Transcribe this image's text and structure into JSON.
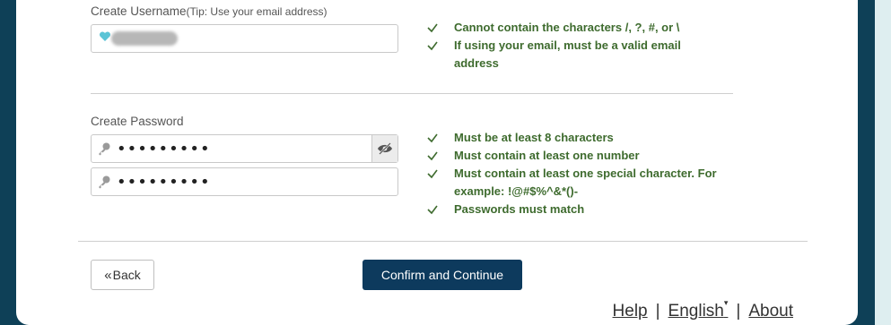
{
  "username": {
    "label": "Create Username",
    "tip": "(Tip: Use your email address)",
    "rules": [
      "Cannot contain the characters /, ?, #, or \\",
      "If using your email, must be a valid email address"
    ]
  },
  "password": {
    "label": "Create Password",
    "value_masked": "•••••••••",
    "confirm_masked": "•••••••••",
    "rules": [
      "Must be at least 8 characters",
      "Must contain at least one number",
      "Must contain at least one special character. For example: !@#$%^&*()-",
      "Passwords must match"
    ]
  },
  "actions": {
    "back_label": "Back",
    "confirm_label": "Confirm and Continue"
  },
  "footer": {
    "help": "Help",
    "language": "English",
    "about": "About",
    "separator": "|"
  },
  "colors": {
    "brand_dark": "#0d3a5d",
    "rule_green": "#3e6b2e",
    "page_bg": "#deeef0"
  }
}
